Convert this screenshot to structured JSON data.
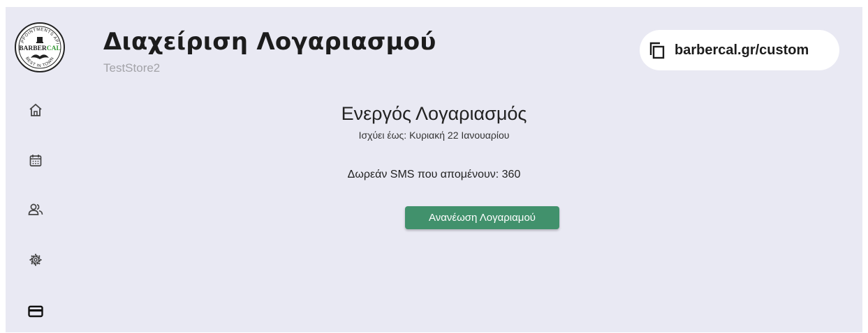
{
  "header": {
    "title": "Διαχείριση Λογαριασμού",
    "store_name": "TestStore2",
    "link_text": "barbercal.gr/custom"
  },
  "logo": {
    "top_text": "APPOINTMENTS APP",
    "brand_part1": "BARBER",
    "brand_part2": "CAL",
    "bottom_text": "BEST IN TOWN"
  },
  "sidebar": {
    "items": [
      {
        "icon": "home-icon"
      },
      {
        "icon": "calendar-icon"
      },
      {
        "icon": "users-icon"
      },
      {
        "icon": "gear-icon"
      },
      {
        "icon": "credit-card-icon",
        "active": true
      }
    ]
  },
  "account": {
    "status_title": "Ενεργός Λογαριασμός",
    "valid_until": "Ισχύει έως: Κυριακή 22 Ιανουαρίου",
    "sms_remaining": "Δωρεάν SMS που απομένουν: 360",
    "renew_label": "Ανανέωση Λογαριαμού"
  },
  "colors": {
    "background": "#e9e9f3",
    "accent_green": "#41916c",
    "logo_green": "#3a9a3a"
  }
}
